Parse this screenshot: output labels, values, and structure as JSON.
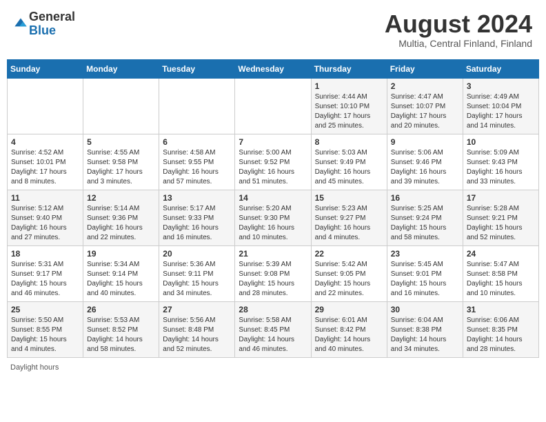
{
  "header": {
    "logo_general": "General",
    "logo_blue": "Blue",
    "month_title": "August 2024",
    "location": "Multia, Central Finland, Finland"
  },
  "days_of_week": [
    "Sunday",
    "Monday",
    "Tuesday",
    "Wednesday",
    "Thursday",
    "Friday",
    "Saturday"
  ],
  "weeks": [
    [
      {
        "day": "",
        "info": ""
      },
      {
        "day": "",
        "info": ""
      },
      {
        "day": "",
        "info": ""
      },
      {
        "day": "",
        "info": ""
      },
      {
        "day": "1",
        "info": "Sunrise: 4:44 AM\nSunset: 10:10 PM\nDaylight: 17 hours\nand 25 minutes."
      },
      {
        "day": "2",
        "info": "Sunrise: 4:47 AM\nSunset: 10:07 PM\nDaylight: 17 hours\nand 20 minutes."
      },
      {
        "day": "3",
        "info": "Sunrise: 4:49 AM\nSunset: 10:04 PM\nDaylight: 17 hours\nand 14 minutes."
      }
    ],
    [
      {
        "day": "4",
        "info": "Sunrise: 4:52 AM\nSunset: 10:01 PM\nDaylight: 17 hours\nand 8 minutes."
      },
      {
        "day": "5",
        "info": "Sunrise: 4:55 AM\nSunset: 9:58 PM\nDaylight: 17 hours\nand 3 minutes."
      },
      {
        "day": "6",
        "info": "Sunrise: 4:58 AM\nSunset: 9:55 PM\nDaylight: 16 hours\nand 57 minutes."
      },
      {
        "day": "7",
        "info": "Sunrise: 5:00 AM\nSunset: 9:52 PM\nDaylight: 16 hours\nand 51 minutes."
      },
      {
        "day": "8",
        "info": "Sunrise: 5:03 AM\nSunset: 9:49 PM\nDaylight: 16 hours\nand 45 minutes."
      },
      {
        "day": "9",
        "info": "Sunrise: 5:06 AM\nSunset: 9:46 PM\nDaylight: 16 hours\nand 39 minutes."
      },
      {
        "day": "10",
        "info": "Sunrise: 5:09 AM\nSunset: 9:43 PM\nDaylight: 16 hours\nand 33 minutes."
      }
    ],
    [
      {
        "day": "11",
        "info": "Sunrise: 5:12 AM\nSunset: 9:40 PM\nDaylight: 16 hours\nand 27 minutes."
      },
      {
        "day": "12",
        "info": "Sunrise: 5:14 AM\nSunset: 9:36 PM\nDaylight: 16 hours\nand 22 minutes."
      },
      {
        "day": "13",
        "info": "Sunrise: 5:17 AM\nSunset: 9:33 PM\nDaylight: 16 hours\nand 16 minutes."
      },
      {
        "day": "14",
        "info": "Sunrise: 5:20 AM\nSunset: 9:30 PM\nDaylight: 16 hours\nand 10 minutes."
      },
      {
        "day": "15",
        "info": "Sunrise: 5:23 AM\nSunset: 9:27 PM\nDaylight: 16 hours\nand 4 minutes."
      },
      {
        "day": "16",
        "info": "Sunrise: 5:25 AM\nSunset: 9:24 PM\nDaylight: 15 hours\nand 58 minutes."
      },
      {
        "day": "17",
        "info": "Sunrise: 5:28 AM\nSunset: 9:21 PM\nDaylight: 15 hours\nand 52 minutes."
      }
    ],
    [
      {
        "day": "18",
        "info": "Sunrise: 5:31 AM\nSunset: 9:17 PM\nDaylight: 15 hours\nand 46 minutes."
      },
      {
        "day": "19",
        "info": "Sunrise: 5:34 AM\nSunset: 9:14 PM\nDaylight: 15 hours\nand 40 minutes."
      },
      {
        "day": "20",
        "info": "Sunrise: 5:36 AM\nSunset: 9:11 PM\nDaylight: 15 hours\nand 34 minutes."
      },
      {
        "day": "21",
        "info": "Sunrise: 5:39 AM\nSunset: 9:08 PM\nDaylight: 15 hours\nand 28 minutes."
      },
      {
        "day": "22",
        "info": "Sunrise: 5:42 AM\nSunset: 9:05 PM\nDaylight: 15 hours\nand 22 minutes."
      },
      {
        "day": "23",
        "info": "Sunrise: 5:45 AM\nSunset: 9:01 PM\nDaylight: 15 hours\nand 16 minutes."
      },
      {
        "day": "24",
        "info": "Sunrise: 5:47 AM\nSunset: 8:58 PM\nDaylight: 15 hours\nand 10 minutes."
      }
    ],
    [
      {
        "day": "25",
        "info": "Sunrise: 5:50 AM\nSunset: 8:55 PM\nDaylight: 15 hours\nand 4 minutes."
      },
      {
        "day": "26",
        "info": "Sunrise: 5:53 AM\nSunset: 8:52 PM\nDaylight: 14 hours\nand 58 minutes."
      },
      {
        "day": "27",
        "info": "Sunrise: 5:56 AM\nSunset: 8:48 PM\nDaylight: 14 hours\nand 52 minutes."
      },
      {
        "day": "28",
        "info": "Sunrise: 5:58 AM\nSunset: 8:45 PM\nDaylight: 14 hours\nand 46 minutes."
      },
      {
        "day": "29",
        "info": "Sunrise: 6:01 AM\nSunset: 8:42 PM\nDaylight: 14 hours\nand 40 minutes."
      },
      {
        "day": "30",
        "info": "Sunrise: 6:04 AM\nSunset: 8:38 PM\nDaylight: 14 hours\nand 34 minutes."
      },
      {
        "day": "31",
        "info": "Sunrise: 6:06 AM\nSunset: 8:35 PM\nDaylight: 14 hours\nand 28 minutes."
      }
    ]
  ],
  "footer": {
    "daylight_hours_label": "Daylight hours"
  }
}
